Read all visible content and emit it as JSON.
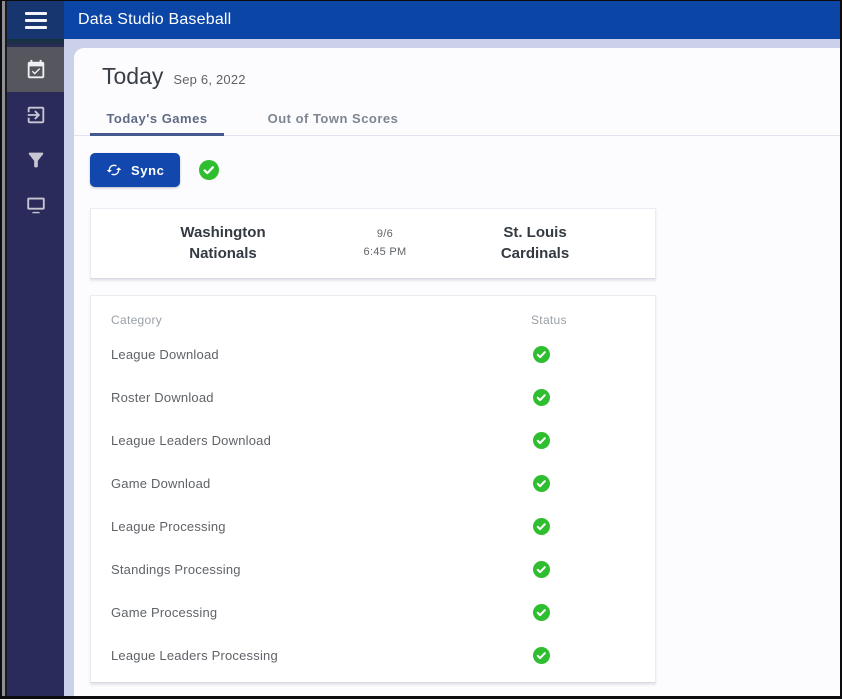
{
  "app": {
    "title": "Data Studio Baseball"
  },
  "sidebar": {
    "items": [
      {
        "name": "calendar-check",
        "active": true
      },
      {
        "name": "file-import",
        "active": false
      },
      {
        "name": "filter",
        "active": false
      },
      {
        "name": "monitor",
        "active": false
      }
    ]
  },
  "page": {
    "title": "Today",
    "date": "Sep 6, 2022"
  },
  "tabs": {
    "today_games": {
      "label": "Today's Games",
      "active": true
    },
    "out_of_town": {
      "label": "Out of Town Scores",
      "active": false
    }
  },
  "sync": {
    "label": "Sync",
    "status": "success",
    "status_icon": "check-circle"
  },
  "game": {
    "away_line1": "Washington",
    "away_line2": "Nationals",
    "date": "9/6",
    "time": "6:45 PM",
    "home_line1": "St. Louis",
    "home_line2": "Cardinals"
  },
  "status_table": {
    "columns": {
      "category": "Category",
      "status": "Status"
    },
    "rows": [
      {
        "category": "League Download",
        "status": "success"
      },
      {
        "category": "Roster Download",
        "status": "success"
      },
      {
        "category": "League Leaders Download",
        "status": "success"
      },
      {
        "category": "Game Download",
        "status": "success"
      },
      {
        "category": "League Processing",
        "status": "success"
      },
      {
        "category": "Standings Processing",
        "status": "success"
      },
      {
        "category": "Game Processing",
        "status": "success"
      },
      {
        "category": "League Leaders Processing",
        "status": "success"
      }
    ]
  },
  "colors": {
    "header_blue": "#0b45a6",
    "hamburger_navy": "#17356e",
    "sidebar_navy": "#2b2b5b",
    "accent_blue": "#1247ad",
    "tab_underline": "#46598f",
    "success_green": "#2fbe2f",
    "background_lavender": "#cbd1ea"
  }
}
